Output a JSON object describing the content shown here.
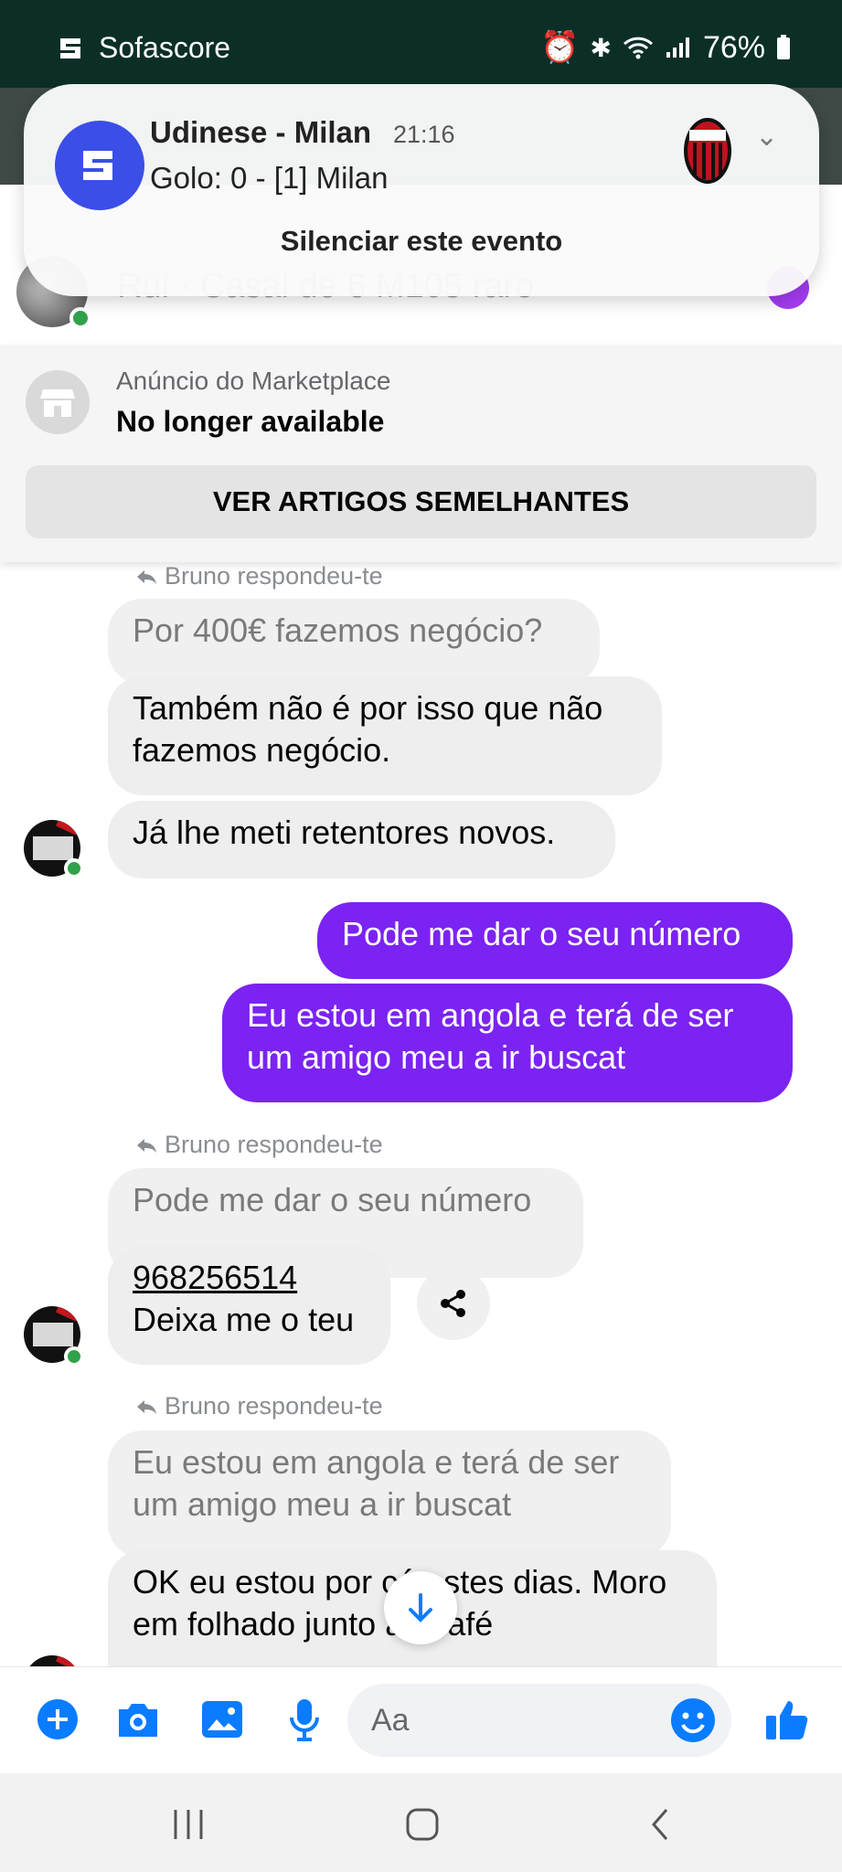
{
  "status_bar": {
    "app_name": "Sofascore",
    "battery": "76%"
  },
  "notification": {
    "title": "Udinese - Milan",
    "time": "21:16",
    "body": "Golo: 0 - [1] Milan",
    "action": "Silenciar este evento"
  },
  "chat_header": {
    "title": "Rui · Casal de 6 M105 raro"
  },
  "marketplace": {
    "label": "Anúncio do Marketplace",
    "status": "No longer available",
    "button": "VER ARTIGOS SEMELHANTES"
  },
  "messages": {
    "reply_label": "Bruno respondeu-te",
    "group1": {
      "quoted": "Por 400€ fazemos negócio?",
      "msg1": "Também não é por isso que não fazemos negócio.",
      "msg2": "Já lhe meti retentores novos."
    },
    "outgoing1": "Pode me dar o seu número",
    "outgoing2": "Eu estou em angola e terá de ser um amigo meu a ir buscat",
    "group2": {
      "quoted": "Pode me dar o seu número",
      "phone": "968256514",
      "text": "Deixa me o teu"
    },
    "group3": {
      "quoted": "Eu estou em angola e terá de ser um amigo meu a ir buscat",
      "msg": "OK eu estou por cá estes dias. Moro em folhado junto ao café"
    }
  },
  "composer": {
    "placeholder": "Aa"
  },
  "colors": {
    "accent": "#7b23f2",
    "messenger_blue": "#0a7cff",
    "status_bar": "#0b2f26"
  }
}
